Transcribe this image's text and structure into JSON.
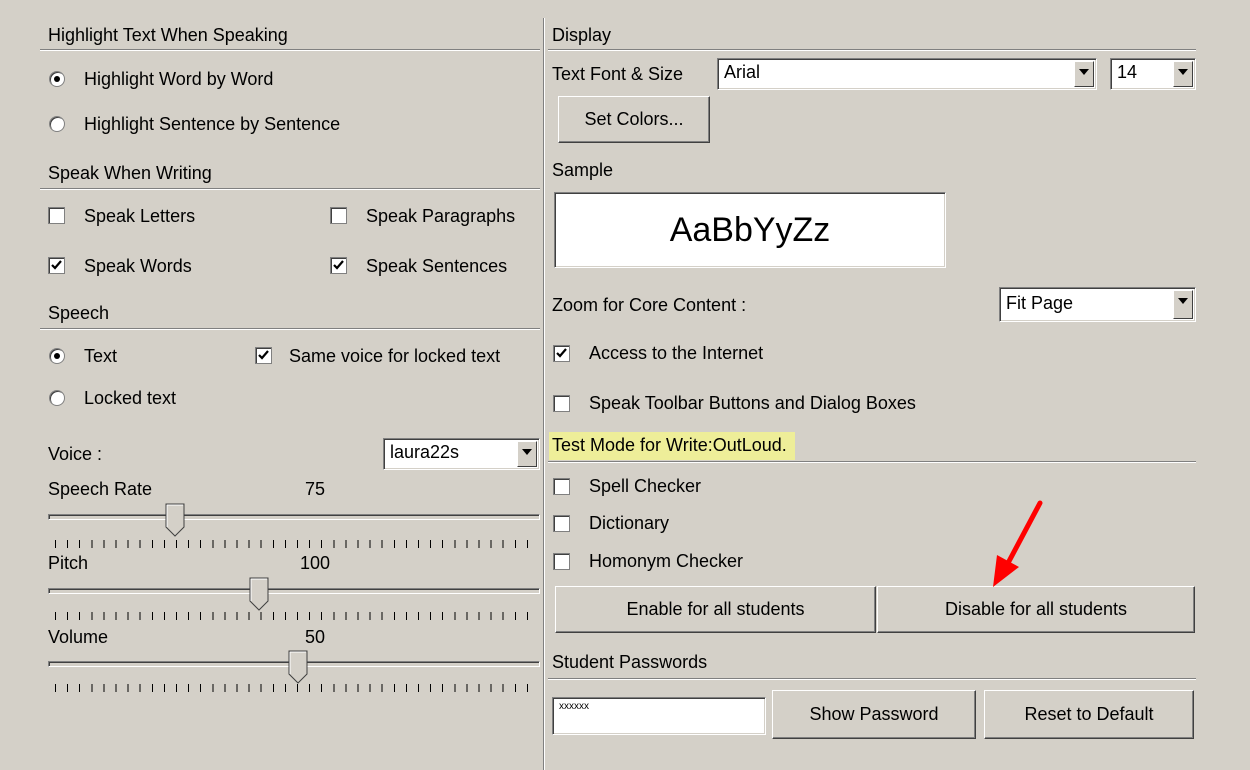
{
  "left": {
    "highlight_section": {
      "title": "Highlight Text When Speaking",
      "options": [
        "Highlight Word by Word",
        "Highlight Sentence by Sentence"
      ],
      "selected": 0
    },
    "speak_section": {
      "title": "Speak When Writing",
      "speak_letters": "Speak Letters",
      "speak_paragraphs": "Speak Paragraphs",
      "speak_words": "Speak Words",
      "speak_sentences": "Speak Sentences"
    },
    "speech_section": {
      "title": "Speech",
      "text_option": "Text",
      "locked_option": "Locked text",
      "same_voice": "Same voice for locked text"
    },
    "voice": {
      "label": "Voice :",
      "value": "laura22s"
    },
    "speech_rate": {
      "label": "Speech Rate",
      "value": "75",
      "level": 0.26
    },
    "pitch": {
      "label": "Pitch",
      "value": "100",
      "level": 0.43
    },
    "volume": {
      "label": "Volume",
      "value": "50",
      "level": 0.51
    }
  },
  "right": {
    "display": {
      "title": "Display",
      "font_label": "Text Font & Size",
      "font_value": "Arial",
      "size_value": "14",
      "set_colors": "Set Colors..."
    },
    "sample": {
      "title": "Sample",
      "text": "AaBbYyZz"
    },
    "zoom": {
      "label": "Zoom for Core Content :",
      "value": "Fit Page"
    },
    "access_internet": "Access to the Internet",
    "speak_toolbar": "Speak Toolbar Buttons and Dialog Boxes",
    "test_mode": {
      "title": "Test Mode for Write:OutLoud.",
      "spell_checker": "Spell Checker",
      "dictionary": "Dictionary",
      "homonym_checker": "Homonym Checker",
      "enable_all": "Enable for all students",
      "disable_all": "Disable for all students"
    },
    "passwords": {
      "title": "Student Passwords",
      "masked_value": "xxxxxx",
      "show_password": "Show Password",
      "reset_default": "Reset to Default"
    }
  },
  "colors": {
    "face": "#d4d0c8",
    "highlight": "#eeee99",
    "arrow": "#ff0000"
  }
}
